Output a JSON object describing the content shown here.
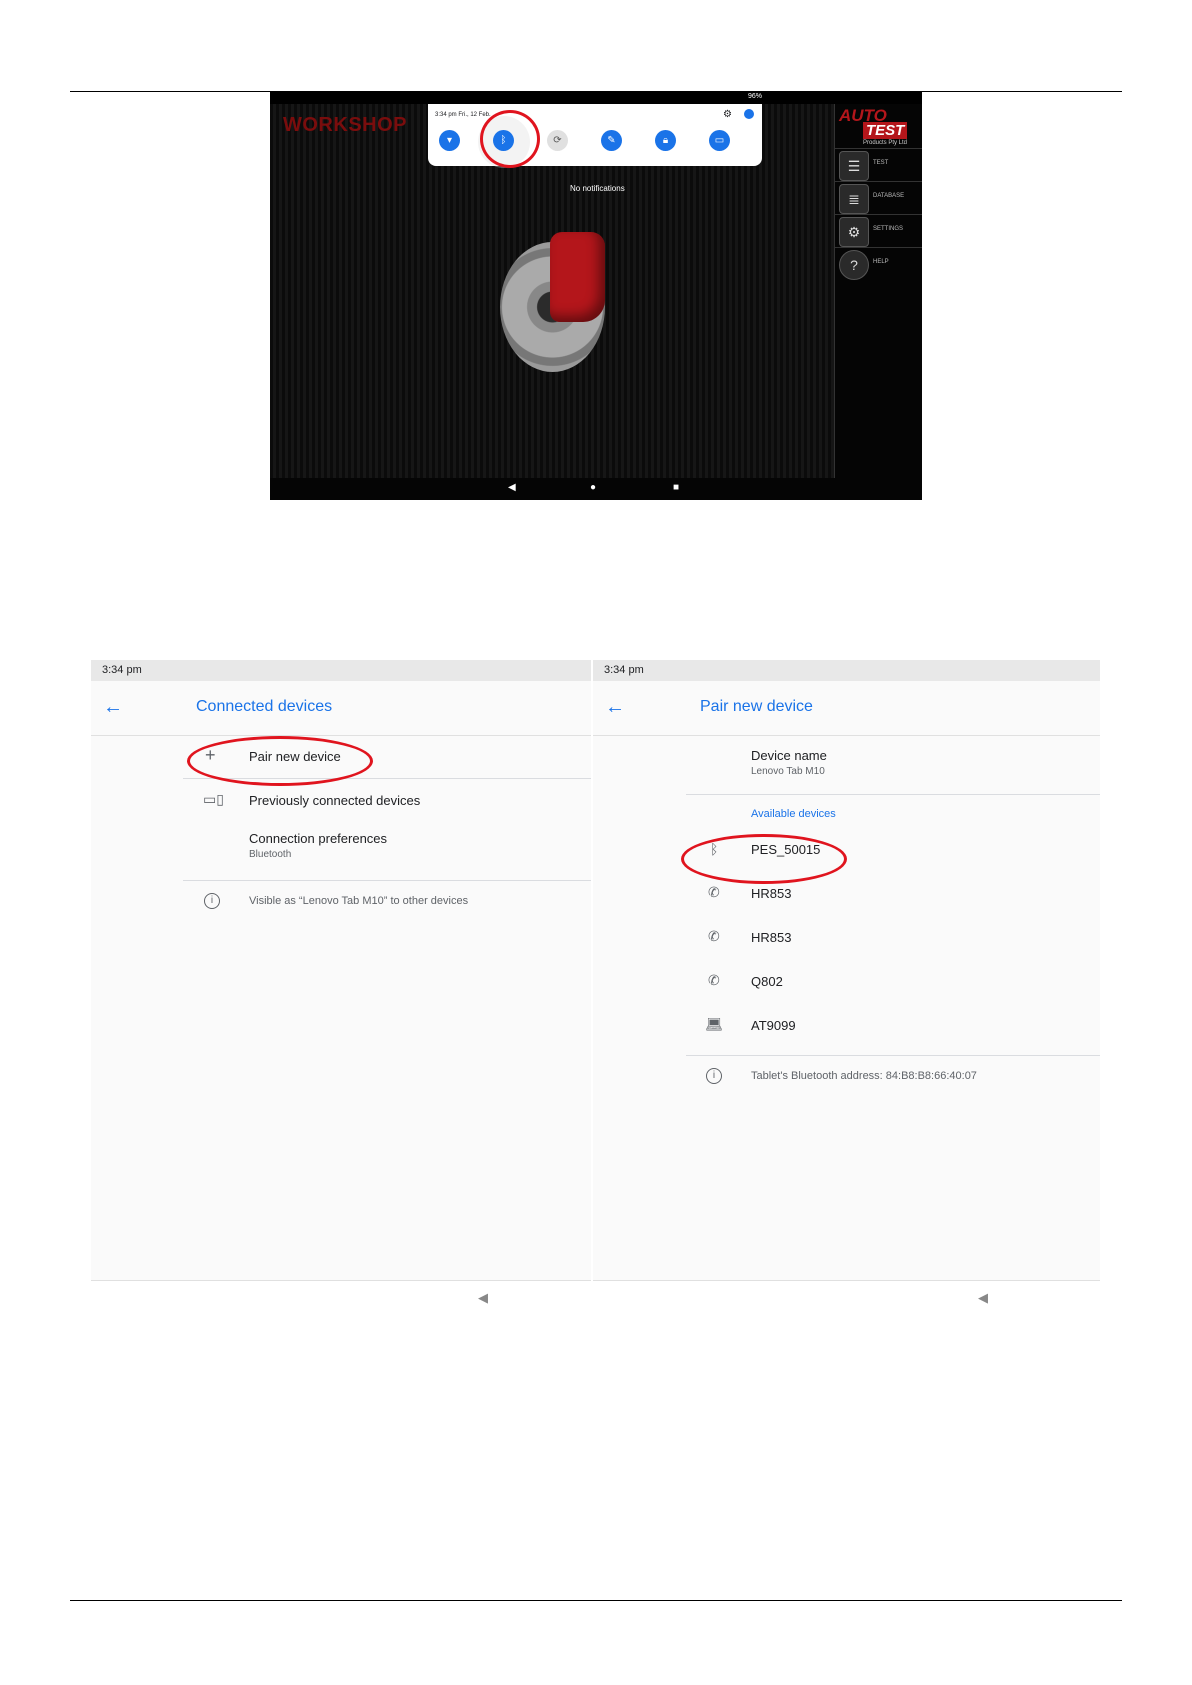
{
  "top_screen": {
    "battery": "96%",
    "app_title": "WORKSHOP",
    "quick_settings_time": "3:34 pm  Fri., 12 Feb.",
    "tiles": [
      {
        "icon": "wifi-icon",
        "glyph": "▾"
      },
      {
        "icon": "bluetooth-icon",
        "glyph": "ᛒ"
      },
      {
        "icon": "auto-rotate-icon",
        "glyph": "⟳"
      },
      {
        "icon": "eye-comfort-icon",
        "glyph": "✎"
      },
      {
        "icon": "lock-icon",
        "glyph": "🔒︎"
      },
      {
        "icon": "screencast-icon",
        "glyph": "▭"
      }
    ],
    "no_notifications": "No notifications",
    "logo": {
      "line1": "AUTO",
      "line2": "TEST",
      "line3": "Products Pty Ltd"
    },
    "menu": [
      "TEST",
      "DATABASE",
      "SETTINGS",
      "HELP"
    ]
  },
  "connected_devices": {
    "status_time": "3:34 pm",
    "title": "Connected devices",
    "items": [
      {
        "label": "Pair new device",
        "icon": "plus-icon"
      },
      {
        "label": "Previously connected devices",
        "icon": "devices-icon"
      },
      {
        "label": "Connection preferences",
        "sub": "Bluetooth"
      }
    ],
    "visible_note": "Visible as “Lenovo Tab M10” to other devices"
  },
  "pair_new_device": {
    "status_time": "3:34 pm",
    "title": "Pair new device",
    "device_name_label": "Device name",
    "device_name_value": "Lenovo Tab M10",
    "available_header": "Available devices",
    "devices": [
      {
        "name": "PES_50015",
        "icon": "bluetooth-icon"
      },
      {
        "name": "HR853",
        "icon": "phone-icon"
      },
      {
        "name": "HR853",
        "icon": "phone-icon"
      },
      {
        "name": "Q802",
        "icon": "phone-icon"
      },
      {
        "name": "AT9099",
        "icon": "laptop-icon"
      }
    ],
    "address_note": "Tablet's Bluetooth address: 84:B8:B8:66:40:07"
  },
  "colors": {
    "accent": "#1a73e8",
    "highlight": "#e0141e",
    "caliper": "#b4161b"
  }
}
